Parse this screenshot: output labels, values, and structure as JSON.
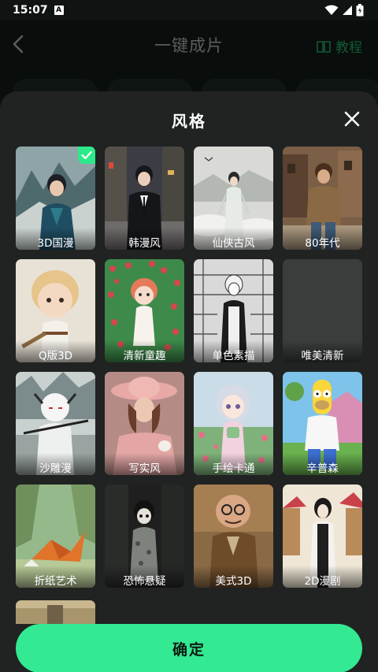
{
  "status_bar": {
    "time": "15:07",
    "notif_glyph": "A"
  },
  "nav": {
    "title": "一键成片",
    "tutorial_label": "教程"
  },
  "sheet": {
    "title": "风格",
    "confirm_label": "确定",
    "styles": [
      {
        "label": "3D国漫",
        "selected": true
      },
      {
        "label": "韩漫风",
        "selected": false
      },
      {
        "label": "仙侠古风",
        "selected": false
      },
      {
        "label": "80年代",
        "selected": false
      },
      {
        "label": "Q版3D",
        "selected": false
      },
      {
        "label": "清新童趣",
        "selected": false
      },
      {
        "label": "单色素描",
        "selected": false
      },
      {
        "label": "唯美清新",
        "selected": false
      },
      {
        "label": "沙雕漫",
        "selected": false
      },
      {
        "label": "写实风",
        "selected": false
      },
      {
        "label": "手绘卡通",
        "selected": false
      },
      {
        "label": "辛普森",
        "selected": false
      },
      {
        "label": "折纸艺术",
        "selected": false
      },
      {
        "label": "恐怖悬疑",
        "selected": false
      },
      {
        "label": "美式3D",
        "selected": false
      },
      {
        "label": "2D漫剧",
        "selected": false
      }
    ]
  },
  "colors": {
    "accent": "#33e992",
    "sheet_bg": "#202322",
    "tutorial": "#1f8a55"
  }
}
